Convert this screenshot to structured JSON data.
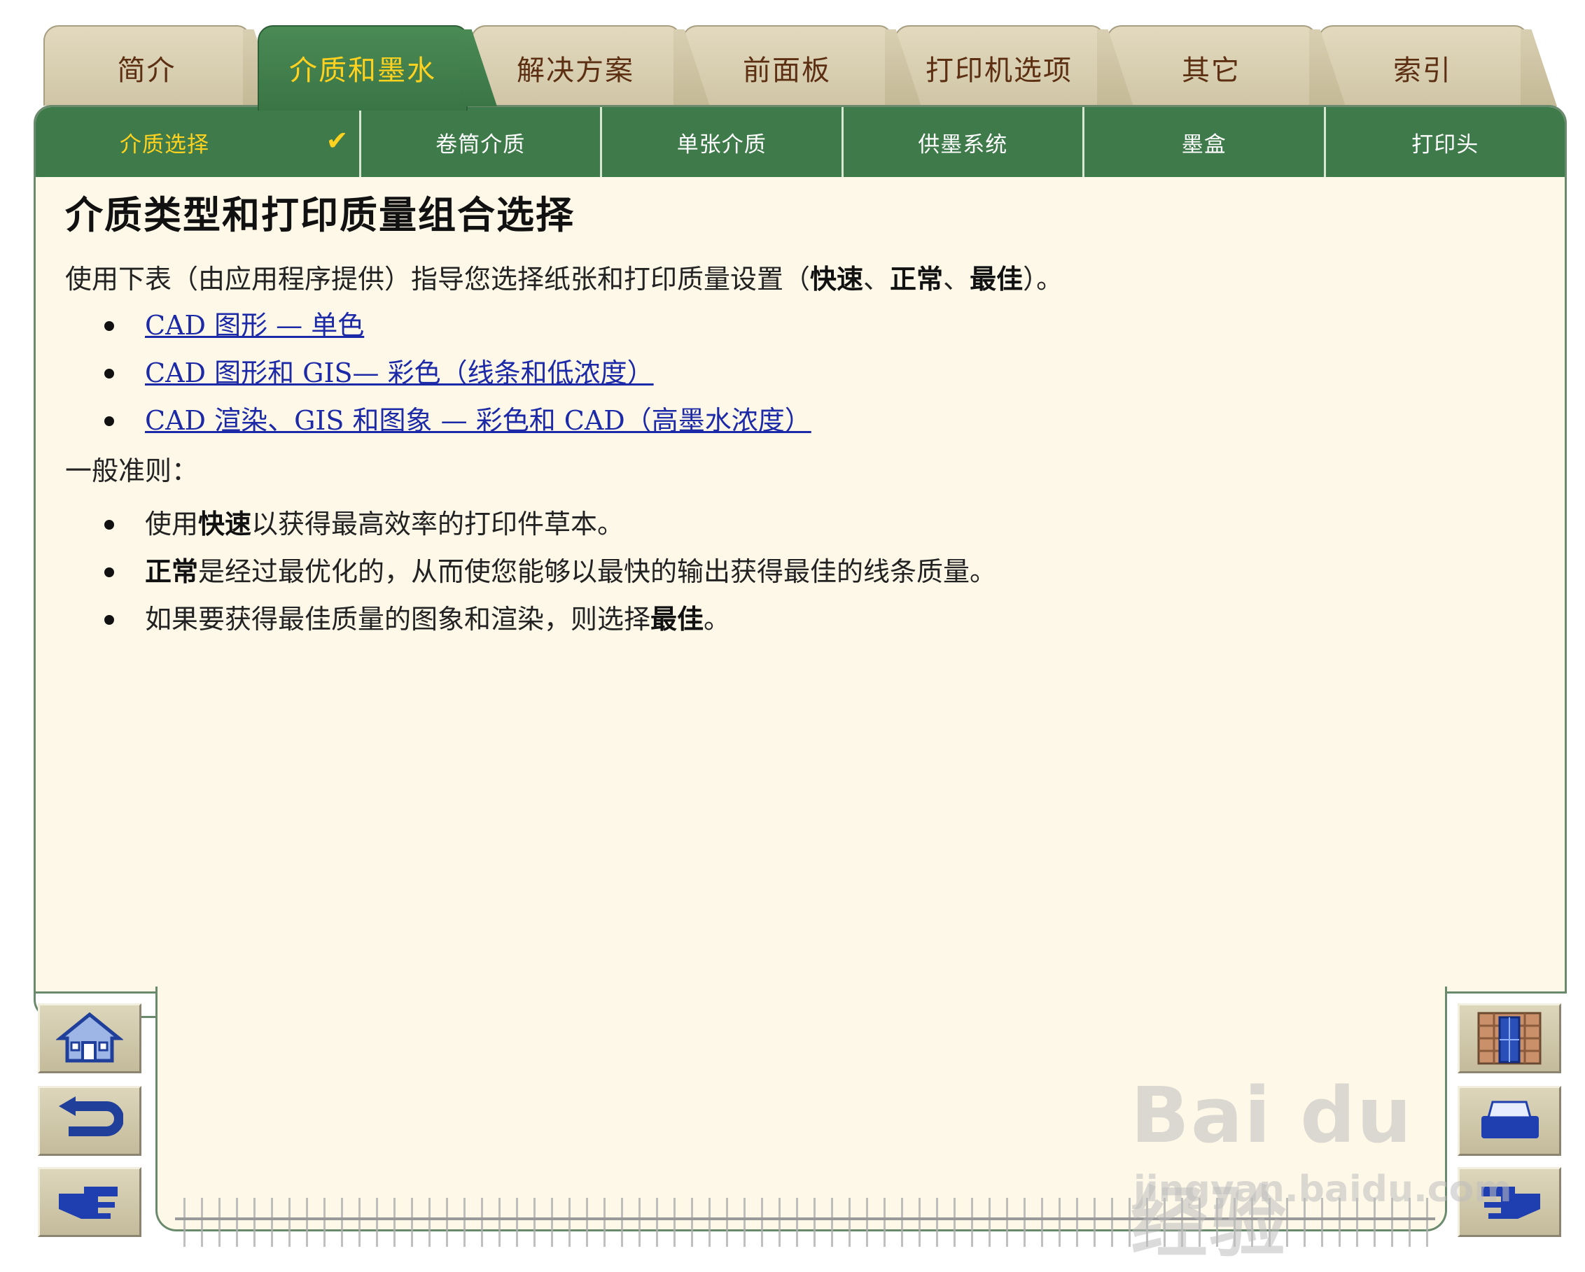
{
  "tabs": [
    {
      "label": "简介"
    },
    {
      "label": "介质和墨水",
      "active": true
    },
    {
      "label": "解决方案"
    },
    {
      "label": "前面板"
    },
    {
      "label": "打印机选项"
    },
    {
      "label": "其它"
    },
    {
      "label": "索引"
    }
  ],
  "subnav": [
    {
      "label": "介质选择",
      "active": true,
      "check": "✔"
    },
    {
      "label": "卷筒介质"
    },
    {
      "label": "单张介质"
    },
    {
      "label": "供墨系统"
    },
    {
      "label": "墨盒"
    },
    {
      "label": "打印头"
    }
  ],
  "content": {
    "title": "介质类型和打印质量组合选择",
    "intro_pre": "使用下表（由应用程序提供）指导您选择纸张和打印质量设置（",
    "intro_q1": "快速",
    "intro_sep1": "、",
    "intro_q2": "正常",
    "intro_sep2": "、",
    "intro_q3": "最佳",
    "intro_post": "）。",
    "links": [
      "CAD 图形 — 单色",
      "CAD 图形和 GIS— 彩色（线条和低浓度）",
      "CAD 渲染、GIS 和图象 — 彩色和 CAD（高墨水浓度）"
    ],
    "general_label": "一般准则：",
    "rule1_pre": "使用",
    "rule1_bold": "快速",
    "rule1_post": "以获得最高效率的打印件草本。",
    "rule2_bold": "正常",
    "rule2_post": "是经过最优化的，从而使您能够以最快的输出获得最佳的线条质量。",
    "rule3_pre": "如果要获得最佳质量的图象和渲染，则选择",
    "rule3_bold": "最佳",
    "rule3_post": "。"
  },
  "nav_buttons": {
    "left": [
      "home-icon",
      "back-arrow-icon",
      "next-hand-icon"
    ],
    "right": [
      "map-icon",
      "printer-icon",
      "previous-hand-icon"
    ]
  },
  "watermark": {
    "big": "Bai du 经验",
    "small": "jingyan.baidu.com"
  },
  "colors": {
    "tab_active": "#3e7a4a",
    "active_text": "#ffd21f",
    "panel_bg": "#fdf8e8",
    "link": "#1d2aa8",
    "tab_text": "#5c2f12"
  }
}
